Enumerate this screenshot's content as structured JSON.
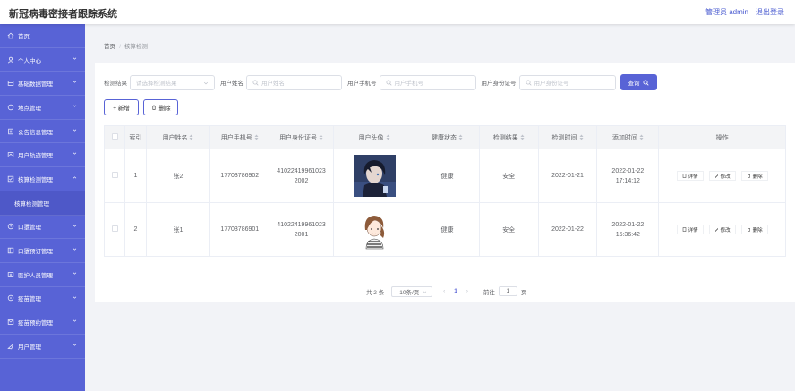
{
  "header": {
    "title": "新冠病毒密接者跟踪系统",
    "user_label": "管理员 admin",
    "logout_label": "退出登录"
  },
  "sidebar": {
    "items": [
      {
        "label": "首页",
        "icon": "home-icon"
      },
      {
        "label": "个人中心",
        "icon": "user-icon"
      },
      {
        "label": "基础数据管理",
        "icon": "database-icon"
      },
      {
        "label": "地点管理",
        "icon": "location-icon"
      },
      {
        "label": "公告信息管理",
        "icon": "notice-icon"
      },
      {
        "label": "用户轨迹管理",
        "icon": "track-icon"
      },
      {
        "label": "核算检测管理",
        "icon": "test-icon"
      },
      {
        "label": "核算检测管理",
        "icon": ""
      },
      {
        "label": "口罩管理",
        "icon": "mask-icon"
      },
      {
        "label": "口罩预订管理",
        "icon": "order-icon"
      },
      {
        "label": "医护人员管理",
        "icon": "doctor-icon"
      },
      {
        "label": "疫苗管理",
        "icon": "vaccine-icon"
      },
      {
        "label": "疫苗预约管理",
        "icon": "appointment-icon"
      },
      {
        "label": "用户管理",
        "icon": "users-icon"
      }
    ]
  },
  "breadcrumb": {
    "home": "首页",
    "separator": "/",
    "current": "核算检测"
  },
  "search": {
    "result_label": "检测结果",
    "result_placeholder": "请选择检测结果",
    "name_label": "用户姓名",
    "name_placeholder": "用户姓名",
    "phone_label": "用户手机号",
    "phone_placeholder": "用户手机号",
    "id_label": "用户身份证号",
    "id_placeholder": "用户身份证号",
    "query_label": "查询"
  },
  "actions": {
    "add_label": "+ 新增",
    "delete_label": "删除"
  },
  "table": {
    "headers": [
      "索引",
      "用户姓名",
      "用户手机号",
      "用户身份证号",
      "用户头像",
      "健康状态",
      "检测结果",
      "检测时间",
      "添加时间",
      "操作"
    ],
    "rows": [
      {
        "index": "1",
        "name": "张2",
        "phone": "17703786902",
        "id_card": "410224199610232002",
        "health": "健康",
        "result": "安全",
        "test_date": "2022-01-21",
        "add_time": "2022-01-22 17:14:12"
      },
      {
        "index": "2",
        "name": "张1",
        "phone": "17703786901",
        "id_card": "410224199610232001",
        "health": "健康",
        "result": "安全",
        "test_date": "2022-01-22",
        "add_time": "2022-01-22 15:36:42"
      }
    ],
    "ops": {
      "detail": "详情",
      "edit": "修改",
      "delete": "删除"
    }
  },
  "pagination": {
    "total": "共 2 条",
    "page_size": "10条/页",
    "current_page": "1",
    "goto_label": "前往",
    "goto_value": "1",
    "page_unit": "页"
  },
  "colors": {
    "primary": "#5863d6",
    "sidebar": "#5863d6"
  }
}
